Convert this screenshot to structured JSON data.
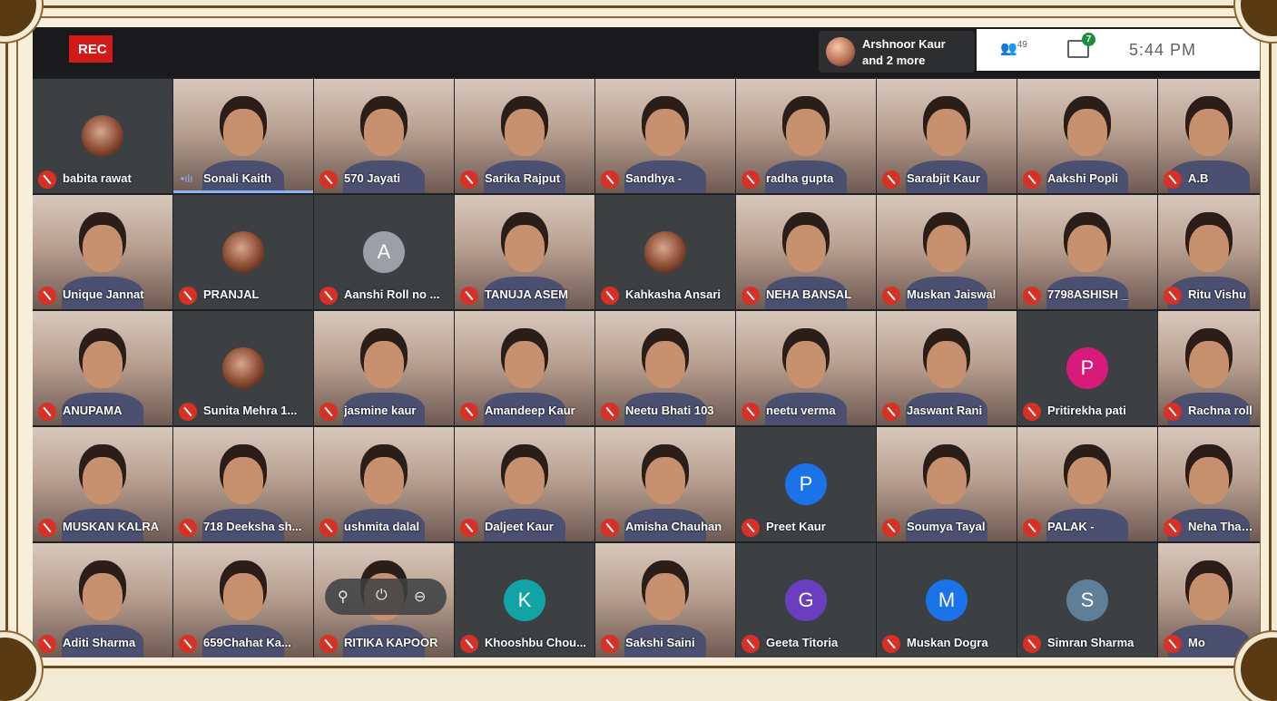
{
  "topbar": {
    "rec": "REC",
    "presenter": {
      "line1": "Arshnoor Kaur",
      "line2": "and 2 more"
    },
    "participants_count": "49",
    "chat_badge": "7",
    "time": "5:44 PM"
  },
  "controls": {
    "pin": "⚲",
    "mute": "⏻",
    "remove": "⊖"
  },
  "tiles": [
    {
      "name": "babita rawat",
      "type": "avatar",
      "avatar": "pic"
    },
    {
      "name": "Sonali Kaith",
      "type": "video",
      "speaking": true
    },
    {
      "name": "570 Jayati",
      "type": "video"
    },
    {
      "name": "Sarika Rajput",
      "type": "video"
    },
    {
      "name": "Sandhya -",
      "type": "video"
    },
    {
      "name": "radha gupta",
      "type": "video"
    },
    {
      "name": "Sarabjit Kaur",
      "type": "video"
    },
    {
      "name": "Aakshi Popli",
      "type": "video"
    },
    {
      "name": "A.B",
      "type": "video"
    },
    {
      "name": "Unique Jannat",
      "type": "video"
    },
    {
      "name": "PRANJAL",
      "type": "avatar",
      "avatar": "pic"
    },
    {
      "name": "Aanshi Roll no ...",
      "type": "avatar",
      "letter": "A",
      "color": "#9aa0a6"
    },
    {
      "name": "TANUJA ASEM",
      "type": "video"
    },
    {
      "name": "Kahkasha Ansari",
      "type": "avatar",
      "avatar": "pic"
    },
    {
      "name": "NEHA BANSAL",
      "type": "video"
    },
    {
      "name": "Muskan Jaiswal",
      "type": "video"
    },
    {
      "name": "7798ASHISH _",
      "type": "video"
    },
    {
      "name": "Ritu Vishu",
      "type": "video"
    },
    {
      "name": "ANUPAMA",
      "type": "video"
    },
    {
      "name": "Sunita Mehra 1...",
      "type": "avatar",
      "avatar": "pic"
    },
    {
      "name": "jasmine kaur",
      "type": "video"
    },
    {
      "name": "Amandeep Kaur",
      "type": "video"
    },
    {
      "name": "Neetu Bhati 103",
      "type": "video"
    },
    {
      "name": "neetu verma",
      "type": "video"
    },
    {
      "name": "Jaswant Rani",
      "type": "video"
    },
    {
      "name": "Pritirekha pati",
      "type": "avatar",
      "letter": "P",
      "color": "#d81b7a"
    },
    {
      "name": "Rachna roll",
      "type": "video"
    },
    {
      "name": "MUSKAN KALRA",
      "type": "video"
    },
    {
      "name": "718 Deeksha sh...",
      "type": "video"
    },
    {
      "name": "ushmita dalal",
      "type": "video"
    },
    {
      "name": "Daljeet Kaur",
      "type": "video"
    },
    {
      "name": "Amisha Chauhan",
      "type": "video"
    },
    {
      "name": "Preet Kaur",
      "type": "avatar",
      "letter": "P",
      "color": "#1a73e8"
    },
    {
      "name": "Soumya Tayal",
      "type": "video"
    },
    {
      "name": "PALAK -",
      "type": "video"
    },
    {
      "name": "Neha Thakur",
      "type": "video"
    },
    {
      "name": "Aditi Sharma",
      "type": "video"
    },
    {
      "name": "659Chahat Ka...",
      "type": "video"
    },
    {
      "name": "RITIKA KAPOOR",
      "type": "video"
    },
    {
      "name": "Khooshbu Chou...",
      "type": "avatar",
      "letter": "K",
      "color": "#12a4a4"
    },
    {
      "name": "Sakshi Saini",
      "type": "video"
    },
    {
      "name": "Geeta Titoria",
      "type": "avatar",
      "letter": "G",
      "color": "#6a3fbf"
    },
    {
      "name": "Muskan Dogra",
      "type": "avatar",
      "letter": "M",
      "color": "#1a73e8"
    },
    {
      "name": "Simran Sharma",
      "type": "avatar",
      "letter": "S",
      "color": "#5f7f99"
    },
    {
      "name": "Mo",
      "type": "video"
    }
  ]
}
